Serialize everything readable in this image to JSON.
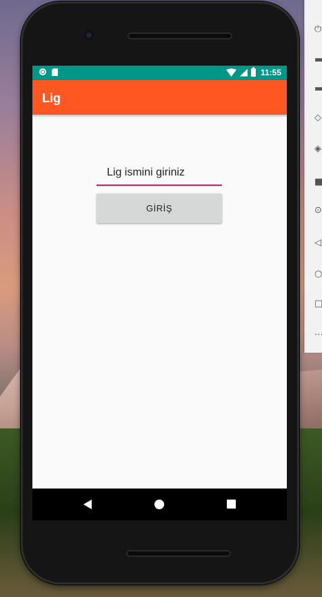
{
  "status_bar": {
    "time": "11:55",
    "icons": [
      "notification-circle-icon",
      "sd-card-icon",
      "wifi-icon",
      "signal-icon",
      "battery-icon"
    ],
    "background_color": "#009688"
  },
  "app_bar": {
    "title": "Lig",
    "background_color": "#ff5722"
  },
  "form": {
    "league_name_input": {
      "value": "",
      "placeholder": "Lig ismini giriniz"
    },
    "submit_button_label": "GİRİŞ",
    "accent_color": "#d81b60"
  },
  "navigation_bar": {
    "buttons": [
      "back-icon",
      "home-icon",
      "recents-icon"
    ]
  }
}
